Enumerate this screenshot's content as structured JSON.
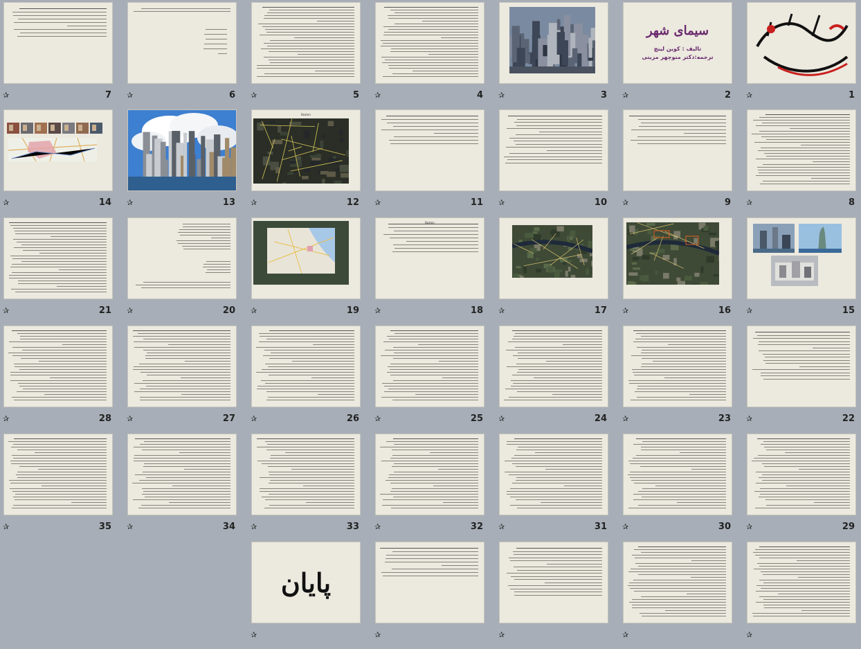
{
  "slides": [
    {
      "n": "1",
      "type": "bismillah",
      "text": "بسم الله الرحمن الرحیم"
    },
    {
      "n": "2",
      "type": "title",
      "title": "سیمای شهر",
      "author": "تالیف : کوین لینچ",
      "translator": "ترجمه:دکتر منوچهر مزینی"
    },
    {
      "n": "3",
      "type": "photo-city"
    },
    {
      "n": "4",
      "type": "text"
    },
    {
      "n": "5",
      "type": "text"
    },
    {
      "n": "6",
      "type": "text-sparse"
    },
    {
      "n": "7",
      "type": "text-short"
    },
    {
      "n": "8",
      "type": "text"
    },
    {
      "n": "9",
      "type": "text-short"
    },
    {
      "n": "10",
      "type": "text-mid"
    },
    {
      "n": "11",
      "type": "text-short"
    },
    {
      "n": "12",
      "type": "map-dark",
      "caption": "Boston"
    },
    {
      "n": "13",
      "type": "photo-skyline"
    },
    {
      "n": "14",
      "type": "photos-map"
    },
    {
      "n": "15",
      "type": "photos-three"
    },
    {
      "n": "16",
      "type": "map-aerial"
    },
    {
      "n": "17",
      "type": "map-aerial2"
    },
    {
      "n": "18",
      "type": "text-short",
      "caption": "Boston"
    },
    {
      "n": "19",
      "type": "map-satellite"
    },
    {
      "n": "20",
      "type": "text-list"
    },
    {
      "n": "21",
      "type": "text"
    },
    {
      "n": "22",
      "type": "text-mid"
    },
    {
      "n": "23",
      "type": "text"
    },
    {
      "n": "24",
      "type": "text"
    },
    {
      "n": "25",
      "type": "text"
    },
    {
      "n": "26",
      "type": "text"
    },
    {
      "n": "27",
      "type": "text"
    },
    {
      "n": "28",
      "type": "text"
    },
    {
      "n": "29",
      "type": "text"
    },
    {
      "n": "30",
      "type": "text"
    },
    {
      "n": "31",
      "type": "text"
    },
    {
      "n": "32",
      "type": "text"
    },
    {
      "n": "33",
      "type": "text"
    },
    {
      "n": "34",
      "type": "text"
    },
    {
      "n": "35",
      "type": "text"
    },
    {
      "n": "",
      "type": "text"
    },
    {
      "n": "",
      "type": "text"
    },
    {
      "n": "",
      "type": "text-mid"
    },
    {
      "n": "",
      "type": "text-short"
    },
    {
      "n": "",
      "type": "end",
      "title": "پایان"
    }
  ],
  "star_glyph": "✰"
}
